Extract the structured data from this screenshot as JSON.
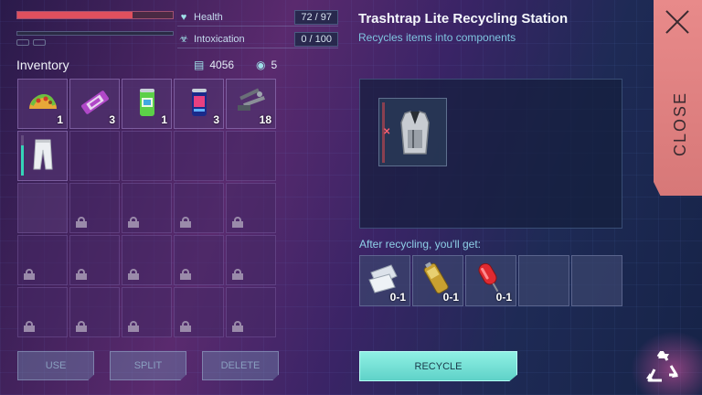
{
  "stats": {
    "health": {
      "label": "Health",
      "value": "72 / 97",
      "fraction": 0.74
    },
    "intoxication": {
      "label": "Intoxication",
      "value": "0 / 100",
      "fraction": 0.0
    }
  },
  "inventory": {
    "title": "Inventory",
    "credits": "4056",
    "tokens": "5",
    "items": [
      {
        "name": "taco",
        "qty": "1"
      },
      {
        "name": "candy-bar",
        "qty": "3"
      },
      {
        "name": "green-soda-can",
        "qty": "1"
      },
      {
        "name": "blue-energy-drink",
        "qty": "3"
      },
      {
        "name": "scrap-parts",
        "qty": "18"
      },
      {
        "name": "white-pants",
        "qty": "",
        "durability": 0.75
      }
    ]
  },
  "buttons": {
    "use": "USE",
    "split": "SPLIT",
    "delete": "DELETE",
    "recycle": "RECYCLE",
    "close": "CLOSE"
  },
  "station": {
    "title": "Trashtrap Lite Recycling Station",
    "subtitle": "Recycles items into components",
    "input_item": "metal-vest",
    "after_label": "After recycling, you'll get:",
    "outputs": [
      {
        "name": "cloth-scraps",
        "qty": "0-1"
      },
      {
        "name": "battery-cell",
        "qty": "0-1"
      },
      {
        "name": "red-capsule",
        "qty": "0-1"
      }
    ]
  },
  "colors": {
    "health": "#e0505e",
    "accent_teal": "#5fd2c8",
    "close_tab": "#e08484"
  }
}
